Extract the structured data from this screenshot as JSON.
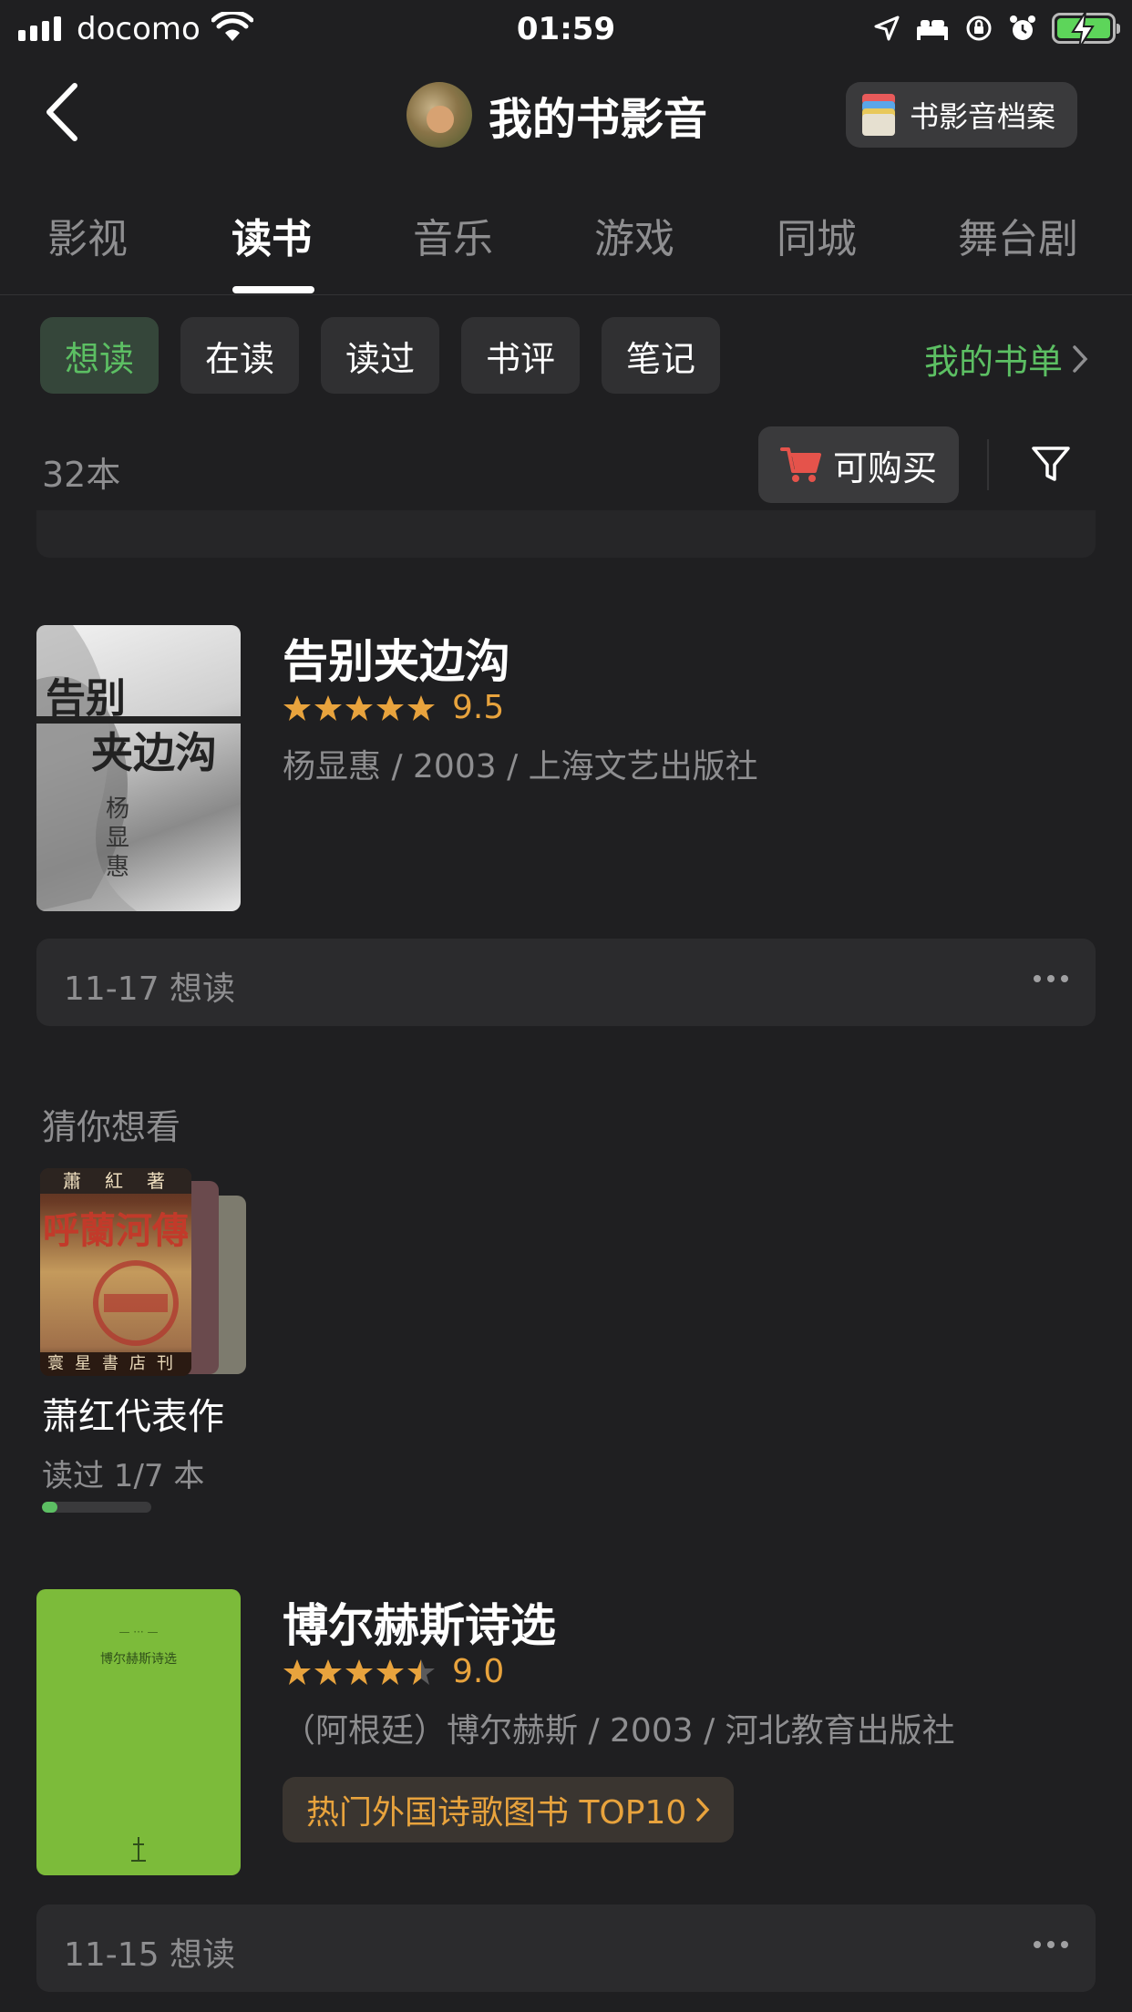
{
  "status_bar": {
    "carrier": "docomo",
    "time": "01:59",
    "battery_color": "#5dd55a"
  },
  "nav": {
    "back_icon": "chevron-left-icon",
    "title": "我的书影音",
    "archive_label": "书影音档案"
  },
  "tabs": [
    {
      "label": "影视",
      "active": false
    },
    {
      "label": "读书",
      "active": true
    },
    {
      "label": "音乐",
      "active": false
    },
    {
      "label": "游戏",
      "active": false
    },
    {
      "label": "同城",
      "active": false
    },
    {
      "label": "舞台剧",
      "active": false
    }
  ],
  "filters": {
    "chips": [
      {
        "label": "想读",
        "active": true
      },
      {
        "label": "在读",
        "active": false
      },
      {
        "label": "读过",
        "active": false
      },
      {
        "label": "书评",
        "active": false
      },
      {
        "label": "笔记",
        "active": false
      }
    ],
    "my_booklist": "我的书单"
  },
  "count_bar": {
    "count": "32本",
    "buyable": "可购买",
    "filter_icon": "funnel-icon"
  },
  "books": [
    {
      "title": "告别夹边沟",
      "stars": 5,
      "rating": "9.5",
      "meta": "杨显惠 / 2003 / 上海文艺出版社",
      "cover_title_top": "告别",
      "cover_title_bottom": "夹边沟",
      "cover_author": "杨显惠",
      "mark_text": "11-17 想读"
    },
    {
      "title": "博尔赫斯诗选",
      "stars": 4.5,
      "rating": "9.0",
      "meta": "（阿根廷）博尔赫斯 / 2003 / 河北教育出版社",
      "cover_title": "博尔赫斯诗选",
      "list_tag": "热门外国诗歌图书 TOP10",
      "mark_text": "11-15 想读"
    }
  ],
  "recommend": {
    "heading": "猜你想看",
    "series_name": "萧红代表作",
    "cover_title": "呼蘭河傳",
    "cover_top": "蕭紅著",
    "cover_bottom": "寰星書店刊",
    "progress_label": "读过 1/7 本",
    "progress_fraction": 0.143
  },
  "colors": {
    "background": "#1f1f21",
    "accent_green": "#5cbf63",
    "rating_orange": "#e8a33d"
  }
}
